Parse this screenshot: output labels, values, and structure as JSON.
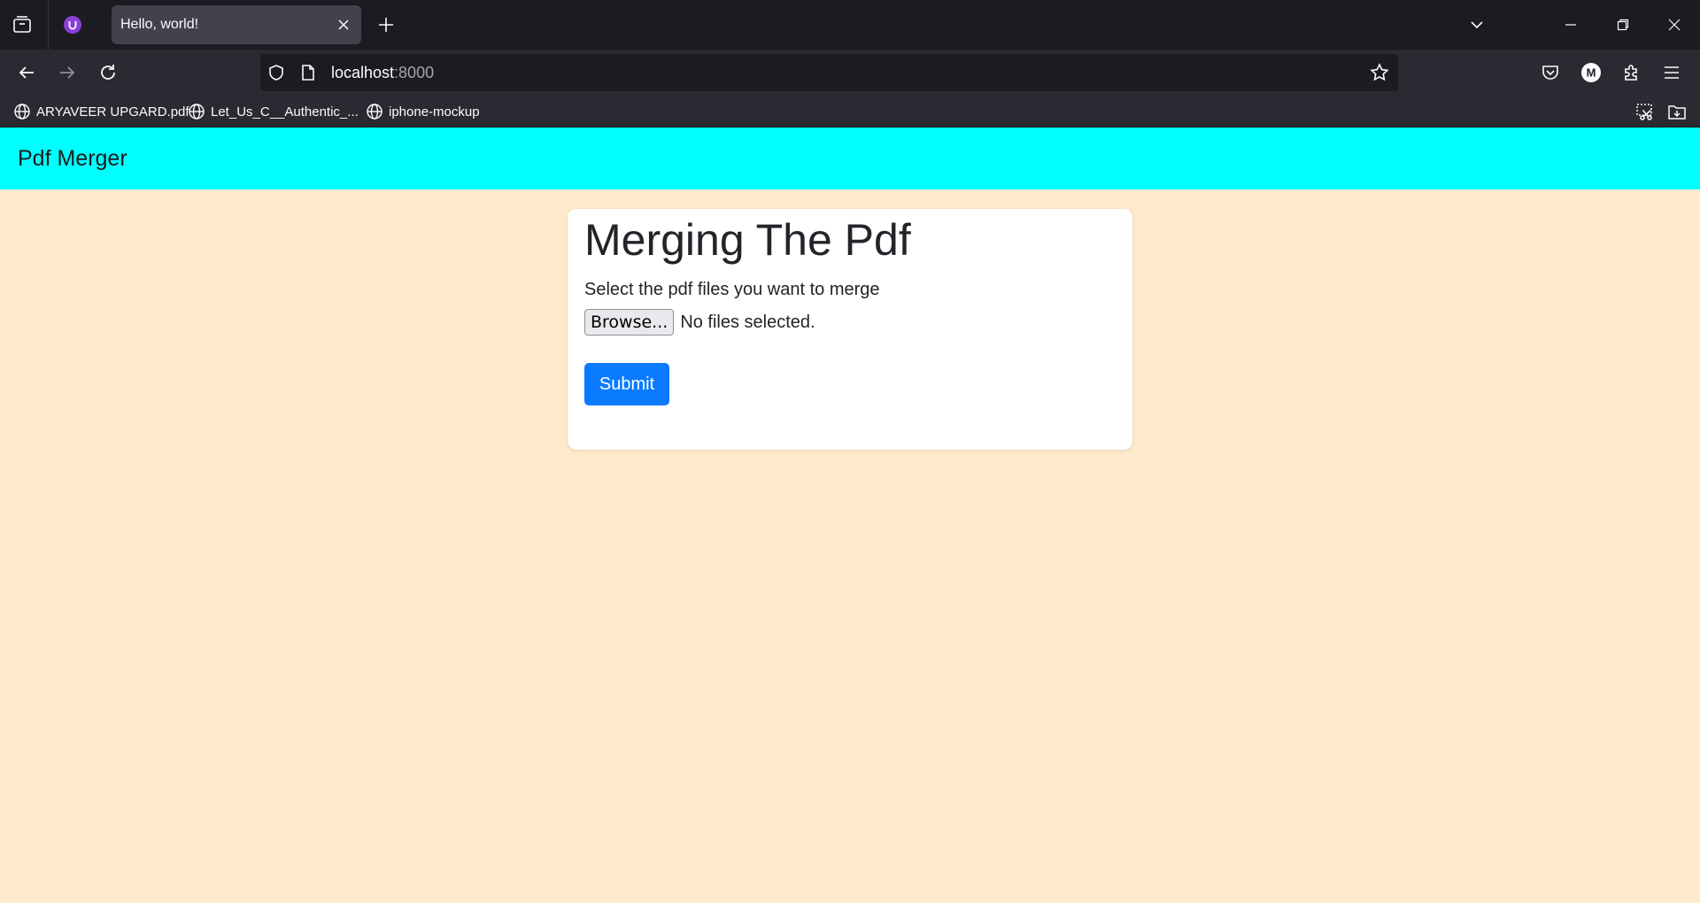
{
  "browser": {
    "tab": {
      "title": "Hello, world!"
    },
    "url": {
      "host": "localhost",
      "port": ":8000"
    },
    "bookmarks": [
      {
        "label": "ARYAVEER UPGARD.pdf"
      },
      {
        "label": "Let_Us_C__Authentic_..."
      },
      {
        "label": "iphone-mockup"
      }
    ],
    "profile_initial": "M"
  },
  "site": {
    "brand": "Pdf Merger"
  },
  "form": {
    "title": "Merging The Pdf",
    "description": "Select the pdf files you want to merge",
    "browse_label": "Browse...",
    "file_status": "No files selected.",
    "submit_label": "Submit"
  },
  "colors": {
    "navbar_bg": "#00ffff",
    "page_bg": "#ffeacb",
    "submit_bg": "#0a7bff"
  }
}
